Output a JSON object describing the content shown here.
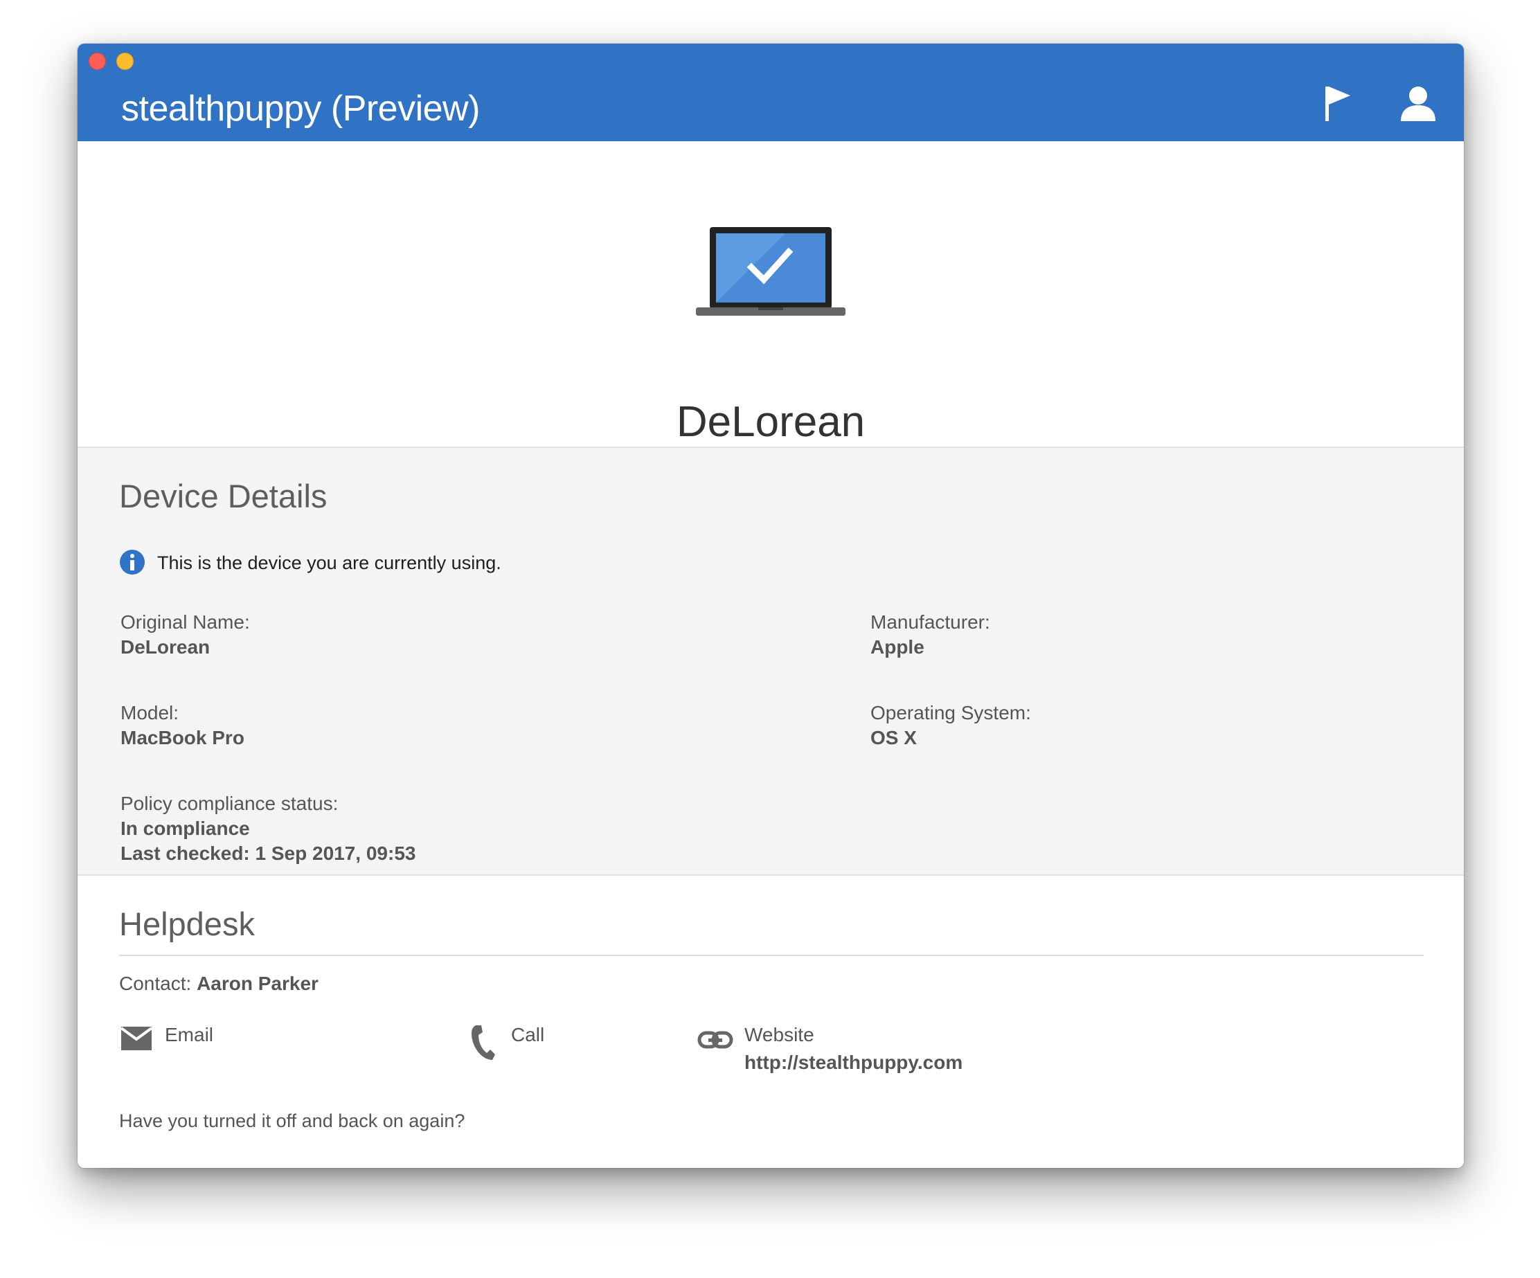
{
  "header": {
    "title": "stealthpuppy (Preview)",
    "accent_color": "#3072c3",
    "icons": [
      "flag-icon",
      "user-icon"
    ]
  },
  "hero": {
    "device_name": "DeLorean",
    "icon": "laptop-check-icon"
  },
  "details": {
    "title": "Device Details",
    "info_message": "This is the device you are currently using.",
    "fields": {
      "original_name": {
        "label": "Original Name:",
        "value": "DeLorean"
      },
      "manufacturer": {
        "label": "Manufacturer:",
        "value": "Apple"
      },
      "model": {
        "label": "Model:",
        "value": "MacBook Pro"
      },
      "operating_system": {
        "label": "Operating System:",
        "value": "OS X"
      },
      "compliance": {
        "label": "Policy compliance status:",
        "value": "In compliance",
        "last_checked": "Last checked: 1 Sep 2017, 09:53"
      }
    }
  },
  "helpdesk": {
    "title": "Helpdesk",
    "contact_label": "Contact:",
    "contact_name": "Aaron Parker",
    "actions": {
      "email": {
        "label": "Email",
        "icon": "envelope-icon"
      },
      "call": {
        "label": "Call",
        "icon": "phone-icon"
      },
      "website": {
        "label": "Website",
        "url": "http://stealthpuppy.com",
        "icon": "link-icon"
      }
    },
    "footer_message": "Have you turned it off and back on again?"
  }
}
